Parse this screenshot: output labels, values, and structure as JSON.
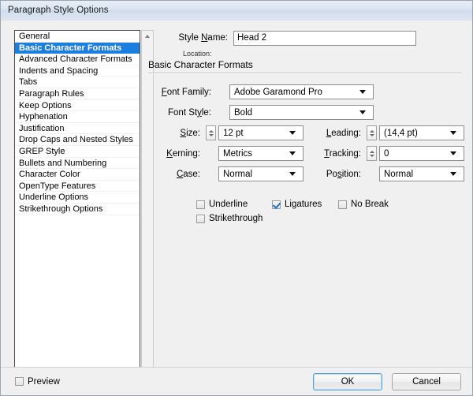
{
  "window": {
    "title": "Paragraph Style Options"
  },
  "sidebar": {
    "items": [
      {
        "label": "General",
        "selected": false
      },
      {
        "label": "Basic Character Formats",
        "selected": true
      },
      {
        "label": "Advanced Character Formats",
        "selected": false
      },
      {
        "label": "Indents and Spacing",
        "selected": false
      },
      {
        "label": "Tabs",
        "selected": false
      },
      {
        "label": "Paragraph Rules",
        "selected": false
      },
      {
        "label": "Keep Options",
        "selected": false
      },
      {
        "label": "Hyphenation",
        "selected": false
      },
      {
        "label": "Justification",
        "selected": false
      },
      {
        "label": "Drop Caps and Nested Styles",
        "selected": false
      },
      {
        "label": "GREP Style",
        "selected": false
      },
      {
        "label": "Bullets and Numbering",
        "selected": false
      },
      {
        "label": "Character Color",
        "selected": false
      },
      {
        "label": "OpenType Features",
        "selected": false
      },
      {
        "label": "Underline Options",
        "selected": false
      },
      {
        "label": "Strikethrough Options",
        "selected": false
      }
    ],
    "scrollbar": {
      "up_arrow": "scroll-up-icon",
      "down_arrow": "scroll-down-icon"
    }
  },
  "main": {
    "style_name": {
      "label": "Style Name:",
      "value": "Head 2"
    },
    "location": {
      "label": "Location:",
      "value": ""
    },
    "section_title": "Basic Character Formats",
    "fields": {
      "font_family": {
        "label": "Font Family:",
        "value": "Adobe Garamond Pro"
      },
      "font_style": {
        "label": "Font Style:",
        "value": "Bold"
      },
      "size": {
        "label": "Size:",
        "value": "12 pt"
      },
      "leading": {
        "label": "Leading:",
        "value": "(14,4 pt)"
      },
      "kerning": {
        "label": "Kerning:",
        "value": "Metrics"
      },
      "tracking": {
        "label": "Tracking:",
        "value": "0"
      },
      "case": {
        "label": "Case:",
        "value": "Normal"
      },
      "position": {
        "label": "Position:",
        "value": "Normal"
      }
    },
    "checkboxes": {
      "underline": {
        "label": "Underline",
        "checked": false
      },
      "ligatures": {
        "label": "Ligatures",
        "checked": true
      },
      "no_break": {
        "label": "No Break",
        "checked": false
      },
      "strikethrough": {
        "label": "Strikethrough",
        "checked": false
      }
    }
  },
  "footer": {
    "preview": {
      "label": "Preview",
      "checked": false
    },
    "ok_label": "OK",
    "cancel_label": "Cancel"
  },
  "colors": {
    "selection_blue": "#1c7fe0",
    "check_blue": "#1a6fc4",
    "dialog_bg": "#f0f0f0",
    "titlebar_top": "#e8eef6"
  }
}
